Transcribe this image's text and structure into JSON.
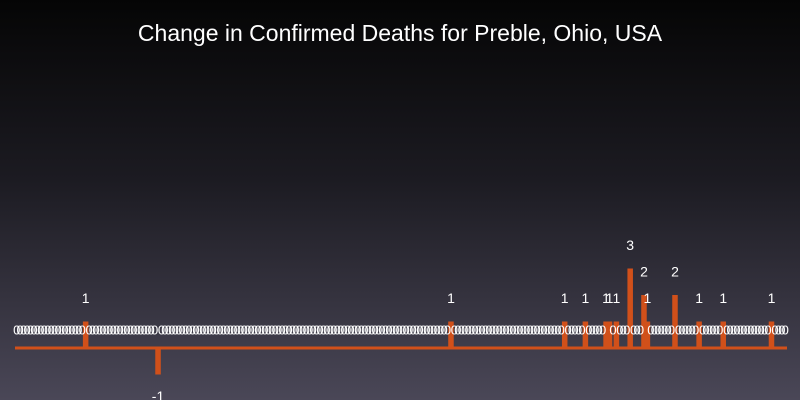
{
  "chart_data": {
    "type": "bar",
    "title": "Change in Confirmed Deaths for Preble, Ohio, USA",
    "xlabel": "",
    "ylabel": "",
    "ylim": [
      -1,
      3
    ],
    "grid": false,
    "values": [
      0,
      0,
      0,
      0,
      0,
      0,
      0,
      0,
      0,
      0,
      0,
      0,
      0,
      0,
      0,
      0,
      0,
      0,
      0,
      0,
      1,
      0,
      0,
      0,
      0,
      0,
      0,
      0,
      0,
      0,
      0,
      0,
      0,
      0,
      0,
      0,
      0,
      0,
      0,
      0,
      0,
      -1,
      0,
      0,
      0,
      0,
      0,
      0,
      0,
      0,
      0,
      0,
      0,
      0,
      0,
      0,
      0,
      0,
      0,
      0,
      0,
      0,
      0,
      0,
      0,
      0,
      0,
      0,
      0,
      0,
      0,
      0,
      0,
      0,
      0,
      0,
      0,
      0,
      0,
      0,
      0,
      0,
      0,
      0,
      0,
      0,
      0,
      0,
      0,
      0,
      0,
      0,
      0,
      0,
      0,
      0,
      0,
      0,
      0,
      0,
      0,
      0,
      0,
      0,
      0,
      0,
      0,
      0,
      0,
      0,
      0,
      0,
      0,
      0,
      0,
      0,
      0,
      0,
      0,
      0,
      0,
      0,
      0,
      0,
      0,
      0,
      1,
      0,
      0,
      0,
      0,
      0,
      0,
      0,
      0,
      0,
      0,
      0,
      0,
      0,
      0,
      0,
      0,
      0,
      0,
      0,
      0,
      0,
      0,
      0,
      0,
      0,
      0,
      0,
      0,
      0,
      0,
      0,
      0,
      1,
      0,
      0,
      0,
      0,
      0,
      1,
      0,
      0,
      0,
      0,
      0,
      1,
      1,
      0,
      1,
      0,
      0,
      0,
      3,
      0,
      0,
      0,
      2,
      1,
      0,
      0,
      0,
      0,
      0,
      0,
      0,
      2,
      0,
      0,
      0,
      0,
      0,
      0,
      1,
      0,
      0,
      0,
      0,
      0,
      0,
      1,
      0,
      0,
      0,
      0,
      0,
      0,
      0,
      0,
      0,
      0,
      0,
      0,
      0,
      1,
      0,
      0,
      0,
      0
    ],
    "bar_color": "#d1501a",
    "axis_color": "#d1501a",
    "label_color": "#ffffff"
  }
}
